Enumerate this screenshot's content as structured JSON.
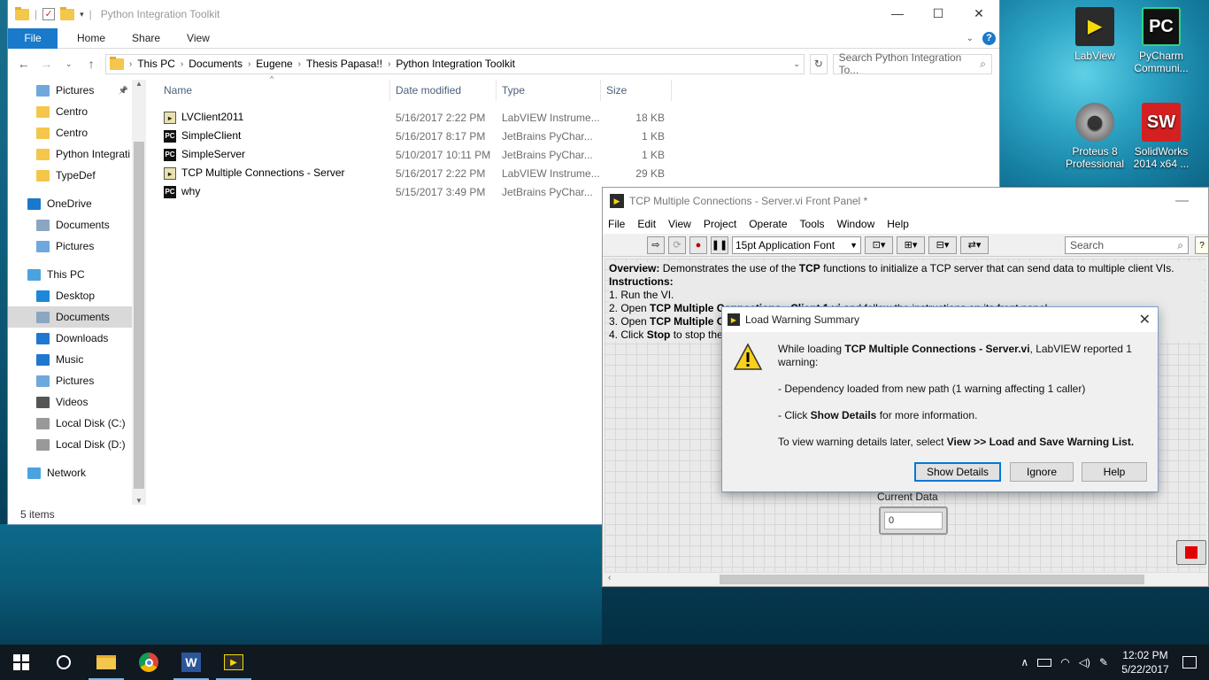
{
  "desktop": {
    "icons": [
      {
        "label": "LabView",
        "icon": "labview-icon"
      },
      {
        "label": "PyCharm Communi...",
        "icon": "pycharm-icon"
      },
      {
        "label": "Proteus 8 Professional",
        "icon": "proteus-icon"
      },
      {
        "label": "SolidWorks 2014 x64 ...",
        "icon": "solidworks-icon"
      }
    ]
  },
  "explorer": {
    "title": "Python Integration Toolkit",
    "window_buttons": {
      "minimize": "—",
      "maximize": "☐",
      "close": "✕"
    },
    "ribbon": {
      "file": "File",
      "tabs": [
        "Home",
        "Share",
        "View"
      ],
      "help": "?"
    },
    "address": {
      "parts": [
        "This PC",
        "Documents",
        "Eugene",
        "Thesis Papasa!!",
        "Python Integration Toolkit"
      ]
    },
    "search_placeholder": "Search Python Integration To...",
    "nav": [
      {
        "label": "Pictures",
        "level": 1,
        "icon": "pictures-icon",
        "pinned": true
      },
      {
        "label": "Centro",
        "level": 1,
        "icon": "folder-icon"
      },
      {
        "label": "Centro",
        "level": 1,
        "icon": "folder-icon"
      },
      {
        "label": "Python Integrati",
        "level": 1,
        "icon": "folder-icon"
      },
      {
        "label": "TypeDef",
        "level": 1,
        "icon": "folder-icon"
      },
      {
        "label": "",
        "level": -1
      },
      {
        "label": "OneDrive",
        "level": 0,
        "icon": "onedrive-icon"
      },
      {
        "label": "Documents",
        "level": 1,
        "icon": "documents-icon"
      },
      {
        "label": "Pictures",
        "level": 1,
        "icon": "pictures-icon"
      },
      {
        "label": "",
        "level": -1
      },
      {
        "label": "This PC",
        "level": 0,
        "icon": "thispc-icon"
      },
      {
        "label": "Desktop",
        "level": 1,
        "icon": "desktop-icon"
      },
      {
        "label": "Documents",
        "level": 1,
        "icon": "documents-icon",
        "selected": true
      },
      {
        "label": "Downloads",
        "level": 1,
        "icon": "downloads-icon"
      },
      {
        "label": "Music",
        "level": 1,
        "icon": "music-icon"
      },
      {
        "label": "Pictures",
        "level": 1,
        "icon": "pictures-icon"
      },
      {
        "label": "Videos",
        "level": 1,
        "icon": "videos-icon"
      },
      {
        "label": "Local Disk (C:)",
        "level": 1,
        "icon": "disk-icon"
      },
      {
        "label": "Local Disk (D:)",
        "level": 1,
        "icon": "disk-icon"
      },
      {
        "label": "",
        "level": -1
      },
      {
        "label": "Network",
        "level": 0,
        "icon": "network-icon"
      }
    ],
    "columns": [
      "Name",
      "Date modified",
      "Type",
      "Size"
    ],
    "files": [
      {
        "name": "LVClient2011",
        "date": "5/16/2017 2:22 PM",
        "type": "LabVIEW Instrume...",
        "size": "18 KB",
        "kind": "lv"
      },
      {
        "name": "SimpleClient",
        "date": "5/16/2017 8:17 PM",
        "type": "JetBrains PyChar...",
        "size": "1 KB",
        "kind": "pc"
      },
      {
        "name": "SimpleServer",
        "date": "5/10/2017 10:11 PM",
        "type": "JetBrains PyChar...",
        "size": "1 KB",
        "kind": "pc"
      },
      {
        "name": "TCP Multiple Connections - Server",
        "date": "5/16/2017 2:22 PM",
        "type": "LabVIEW Instrume...",
        "size": "29 KB",
        "kind": "lv"
      },
      {
        "name": "why",
        "date": "5/15/2017 3:49 PM",
        "type": "JetBrains PyChar...",
        "size": "1 KB",
        "kind": "pc"
      }
    ],
    "status": "5 items"
  },
  "labview": {
    "title": "TCP Multiple Connections - Server.vi Front Panel *",
    "menu": [
      "File",
      "Edit",
      "View",
      "Project",
      "Operate",
      "Tools",
      "Window",
      "Help"
    ],
    "font_select": "15pt Application Font",
    "search_placeholder": "Search",
    "text": {
      "overview_label": "Overview:",
      "overview_pre": " Demonstrates the use of the ",
      "overview_tcp": "TCP",
      "overview_post": " functions to initialize a TCP server that can send data to multiple client VIs.",
      "instructions": "Instructions:",
      "step1": "1. Run the VI.",
      "step2_pre": "2. Open ",
      "step2_bold": "TCP Multiple Connections - Client 1.vi",
      "step2_post": " and follow the instructions on its front panel.",
      "step3_pre": "3. Open ",
      "step3_bold": "TCP Multiple Co",
      "step4_pre": "4. Click ",
      "step4_bold": "Stop",
      "step4_post": " to stop the"
    },
    "current_data_label": "Current Data",
    "current_data_value": "0"
  },
  "dialog": {
    "title": "Load Warning Summary",
    "line1_pre": "While loading ",
    "line1_bold": "TCP Multiple Connections - Server.vi",
    "line1_post": ", LabVIEW reported 1 warning:",
    "line2": " - Dependency loaded from new path (1 warning affecting 1 caller)",
    "line3_pre": " - Click ",
    "line3_bold": "Show Details",
    "line3_post": " for more information.",
    "line4_pre": "To view warning details later, select ",
    "line4_bold": "View >> Load and Save Warning List.",
    "buttons": {
      "show_details": "Show Details",
      "ignore": "Ignore",
      "help": "Help"
    }
  },
  "taskbar": {
    "time": "12:02 PM",
    "date": "5/22/2017"
  }
}
